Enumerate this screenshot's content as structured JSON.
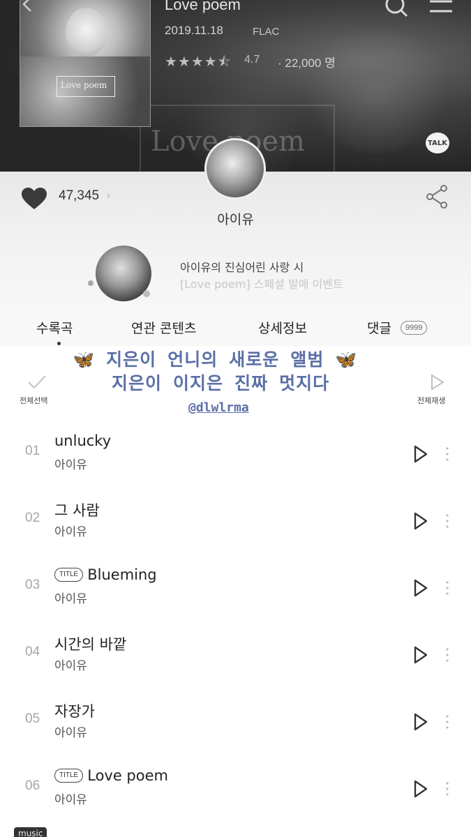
{
  "album": {
    "title": "Love poem",
    "date": "2019.11.18",
    "format": "FLAC",
    "stars": "★★★★⯪",
    "rating": "4.7",
    "rating_count": "· 22,000 명",
    "cover_title": "Love poem",
    "background_title": "Love poem"
  },
  "header": {
    "talk_label": "TALK"
  },
  "likes": {
    "count": "47,345",
    "chevron": "›"
  },
  "artist": {
    "name": "아이유"
  },
  "event": {
    "line1": "아이유의 진심어린 사랑 시",
    "line2": "[Love poem] 스페셜 발매 이벤트"
  },
  "tabs": [
    {
      "label": "수록곡"
    },
    {
      "label": "연관 콘텐츠"
    },
    {
      "label": "상세정보"
    },
    {
      "label": "댓글"
    }
  ],
  "comment_badge": "9999",
  "sticker": {
    "line1": "🦋 지은이 언니의 새로운 앨범 🦋",
    "line2": "지은이 이지은 진짜 멋지다",
    "handle": "@dlwlrma"
  },
  "controls": {
    "select_all": "전체선택",
    "play_all": "전체재생"
  },
  "tracks": [
    {
      "num": "01",
      "title": "unlucky",
      "artist": "아이유",
      "badge": ""
    },
    {
      "num": "02",
      "title": "그 사람",
      "artist": "아이유",
      "badge": ""
    },
    {
      "num": "03",
      "title": "Blueming",
      "artist": "아이유",
      "badge": "TITLE"
    },
    {
      "num": "04",
      "title": "시간의 바깥",
      "artist": "아이유",
      "badge": ""
    },
    {
      "num": "05",
      "title": "자장가",
      "artist": "아이유",
      "badge": ""
    },
    {
      "num": "06",
      "title": "Love poem",
      "artist": "아이유",
      "badge": "TITLE"
    }
  ],
  "footer": {
    "music_tag": "music"
  },
  "colors": {
    "sticker_text": "#5a6fa6",
    "header_bg": "#2a2a2a"
  }
}
